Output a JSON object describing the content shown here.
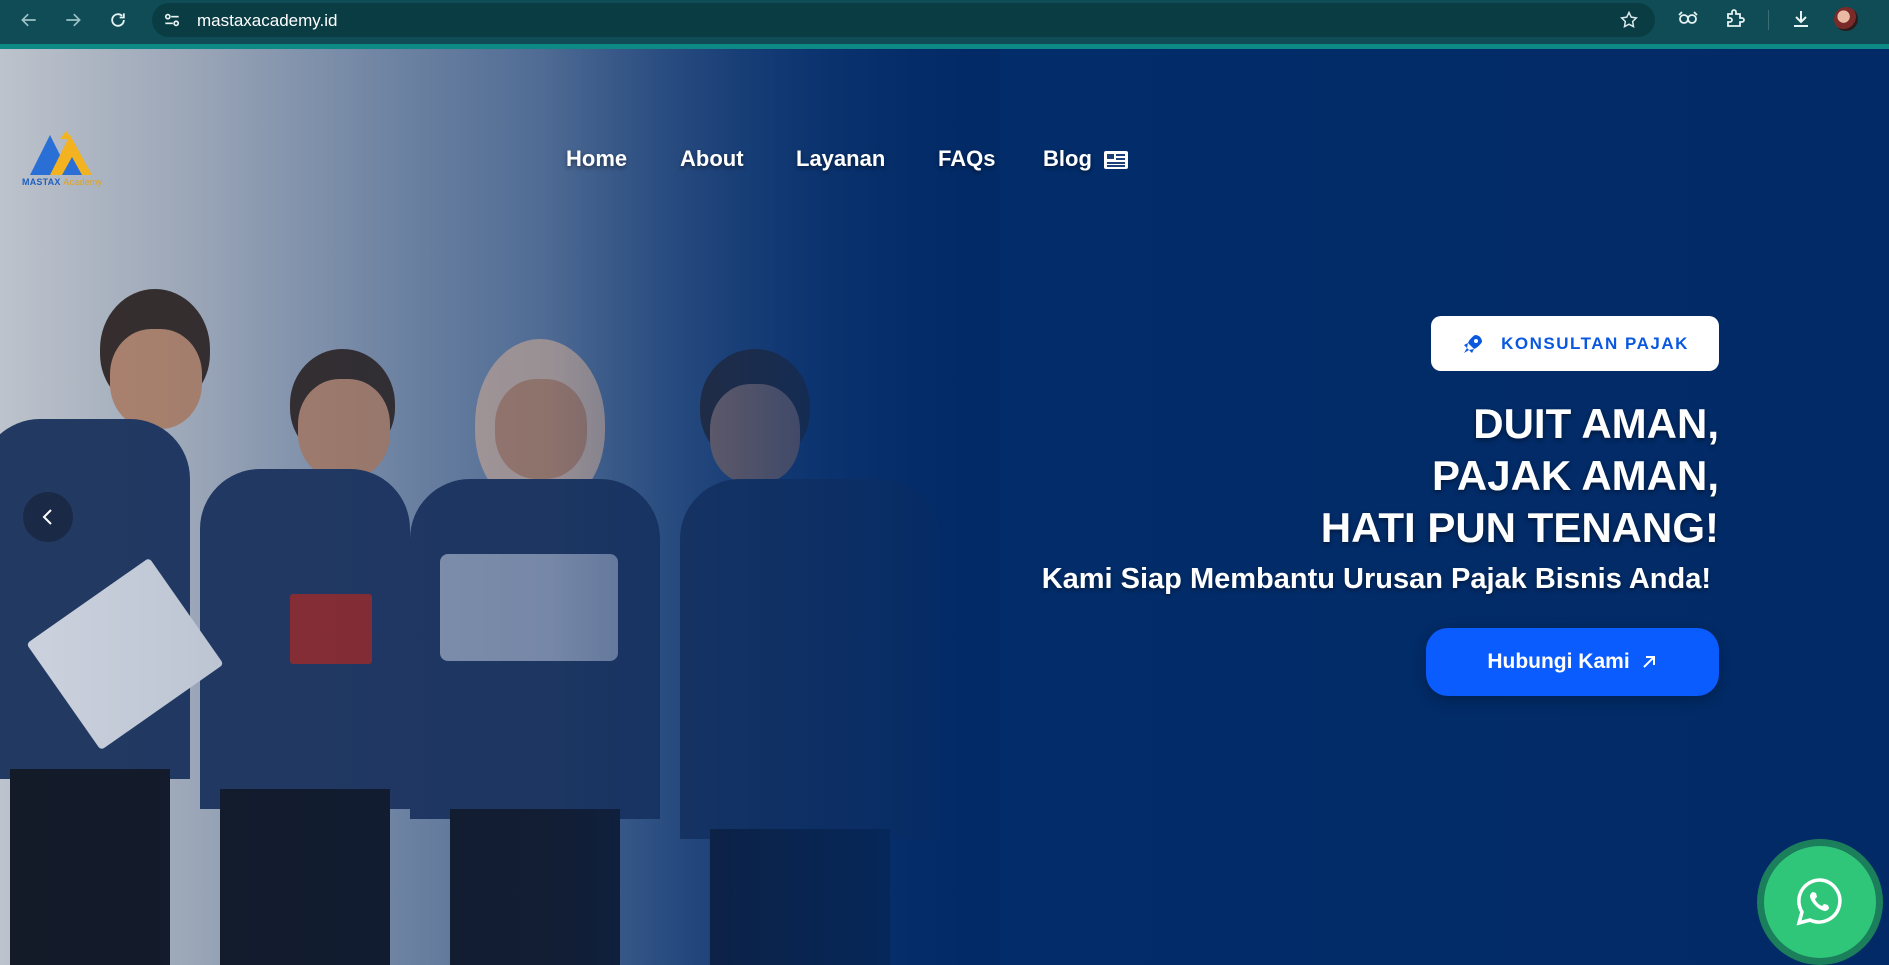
{
  "browser": {
    "url": "mastaxacademy.id",
    "icons": [
      "back-icon",
      "forward-icon",
      "reload-icon",
      "site-info-icon",
      "star-icon",
      "extension-eye-icon",
      "puzzle-icon",
      "download-icon",
      "profile-avatar"
    ]
  },
  "site": {
    "logo_text_main": "MASTAX",
    "logo_text_sub": "Academy",
    "nav": [
      {
        "label": "Home"
      },
      {
        "label": "About"
      },
      {
        "label": "Layanan"
      },
      {
        "label": "FAQs"
      },
      {
        "label": "Blog"
      }
    ]
  },
  "hero": {
    "badge_label": "KONSULTAN PAJAK",
    "headline": [
      "DUIT AMAN,",
      "PAJAK AMAN,",
      "HATI PUN TENANG!"
    ],
    "subheadline": "Kami Siap Membantu Urusan Pajak Bisnis Anda!",
    "cta_label": "Hubungi Kami"
  },
  "colors": {
    "chrome_bg": "#0f4c55",
    "hero_bg": "#022a66",
    "accent_blue": "#0a5cff",
    "whatsapp_green": "#2fc67a"
  }
}
